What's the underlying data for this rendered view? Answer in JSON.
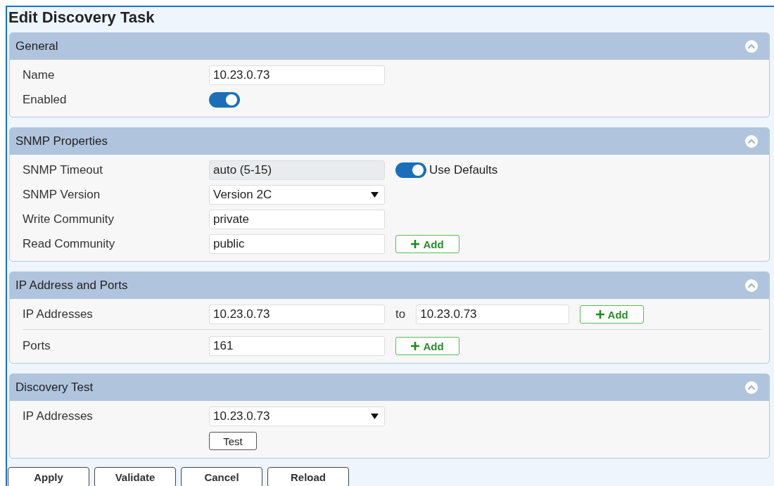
{
  "title": "Edit Discovery Task",
  "sections": [
    {
      "title": "General",
      "expanded": true,
      "rows": [
        {
          "label": "Name",
          "controls": [
            {
              "kind": "input",
              "value": "10.23.0.73"
            }
          ]
        },
        {
          "label": "Enabled",
          "controls": [
            {
              "kind": "toggle",
              "on": true
            }
          ]
        }
      ]
    },
    {
      "title": "SNMP Properties",
      "expanded": true,
      "rows": [
        {
          "label": "SNMP Timeout",
          "controls": [
            {
              "kind": "readonly",
              "value": "auto (5-15)"
            },
            {
              "kind": "toggle",
              "on": true,
              "label": "Use Defaults"
            }
          ]
        },
        {
          "label": "SNMP Version",
          "controls": [
            {
              "kind": "select",
              "value": "Version 2C"
            }
          ]
        },
        {
          "label": "Write Community",
          "controls": [
            {
              "kind": "input",
              "value": "private"
            }
          ]
        },
        {
          "label": "Read Community",
          "controls": [
            {
              "kind": "input",
              "value": "public"
            },
            {
              "kind": "add",
              "label": "Add"
            }
          ]
        }
      ]
    },
    {
      "title": "IP Address and Ports",
      "expanded": true,
      "rows": [
        {
          "label": "IP Addresses",
          "divider": false,
          "controls": [
            {
              "kind": "input",
              "value": "10.23.0.73"
            },
            {
              "kind": "text",
              "value": "to"
            },
            {
              "kind": "input",
              "value": "10.23.0.73"
            },
            {
              "kind": "add",
              "label": "Add"
            }
          ]
        },
        {
          "label": "Ports",
          "divider": true,
          "controls": [
            {
              "kind": "input",
              "value": "161"
            },
            {
              "kind": "add",
              "label": "Add"
            }
          ]
        }
      ]
    },
    {
      "title": "Discovery Test",
      "expanded": true,
      "rows": [
        {
          "label": "IP Addresses",
          "controls": [
            {
              "kind": "select",
              "value": "10.23.0.73"
            }
          ]
        },
        {
          "controls": [
            {
              "kind": "button",
              "label": "Test"
            }
          ]
        }
      ]
    }
  ],
  "buttons": [
    "Apply",
    "Validate",
    "Cancel",
    "Reload"
  ]
}
